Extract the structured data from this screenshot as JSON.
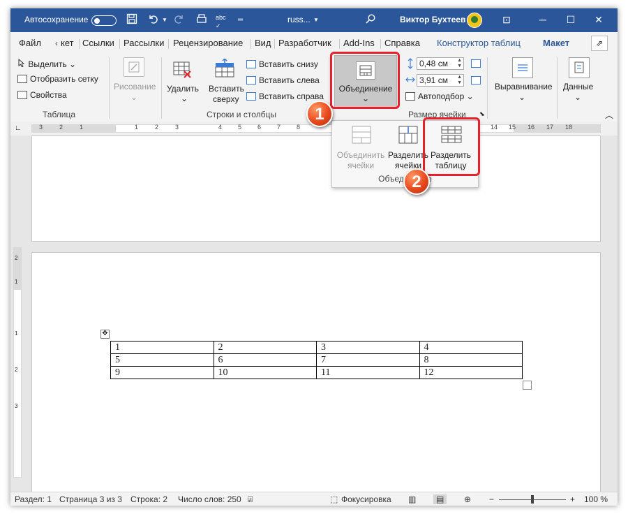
{
  "titlebar": {
    "autosave_label": "Автосохранение",
    "autosave_state": "off",
    "doc_name": "russ...",
    "user_name": "Виктор Бухтеев",
    "accent": "#2b579a",
    "icons": [
      "save-icon",
      "undo-icon",
      "redo-icon",
      "touch-mode-icon",
      "spelling-icon",
      "customize-qa-icon",
      "search-icon"
    ],
    "spell_text": "abc"
  },
  "window_controls": {
    "ribbon_display": "⊡",
    "minimize": "─",
    "maximize": "☐",
    "close": "✕"
  },
  "tabs": [
    {
      "label": "Файл"
    },
    {
      "label": "кет"
    },
    {
      "label": "Ссылки"
    },
    {
      "label": "Рассылки"
    },
    {
      "label": "Рецензирование"
    },
    {
      "label": "Вид"
    },
    {
      "label": "Разработчик"
    },
    {
      "label": "Add-Ins"
    },
    {
      "label": "Справка"
    },
    {
      "label": "Конструктор таблиц"
    },
    {
      "label": "Макет"
    }
  ],
  "active_tab": "Макет",
  "ribbon": {
    "table_group": {
      "label": "Таблица",
      "select": "Выделить",
      "gridlines": "Отобразить сетку",
      "properties": "Свойства"
    },
    "drawing": {
      "label": "Рисование"
    },
    "rows_cols": {
      "label": "Строки и столбцы",
      "delete": "Удалить",
      "insert_above_1": "Вставить",
      "insert_above_2": "сверху",
      "insert_below": "Вставить снизу",
      "insert_left": "Вставить слева",
      "insert_right": "Вставить справа"
    },
    "merge": {
      "label": "Объединение"
    },
    "cell_size": {
      "label": "Размер ячейки",
      "height": "0,48 см",
      "width": "3,91 см",
      "autofit": "Автоподбор"
    },
    "alignment": {
      "label": "Выравнивание"
    },
    "data": {
      "label": "Данные"
    }
  },
  "dropdown": {
    "merge_cells_1": "Объединить",
    "merge_cells_2": "ячейки",
    "split_cells_1": "Разделить",
    "split_cells_2": "ячейки",
    "split_table_1": "Разделить",
    "split_table_2": "таблицу",
    "group_label": "Объединение"
  },
  "callouts": [
    {
      "number": "1"
    },
    {
      "number": "2"
    }
  ],
  "ruler": {
    "h_numbers": [
      "3",
      "2",
      "1",
      "1",
      "2",
      "3",
      "4",
      "5",
      "6",
      "7",
      "8",
      "14",
      "15",
      "16",
      "17",
      "18"
    ],
    "v_numbers": [
      "2",
      "1",
      "1",
      "2",
      "3"
    ]
  },
  "table": {
    "rows": [
      [
        "1",
        "2",
        "3",
        "4"
      ],
      [
        "5",
        "6",
        "7",
        "8"
      ],
      [
        "9",
        "10",
        "11",
        "12"
      ]
    ]
  },
  "statusbar": {
    "section": "Раздел: 1",
    "page": "Страница 3 из 3",
    "line": "Строка: 2",
    "words": "Число слов: 250",
    "focus": "Фокусировка",
    "zoom_minus": "−",
    "zoom_plus": "+",
    "zoom": "100 %",
    "zoom_level": 0.5
  }
}
